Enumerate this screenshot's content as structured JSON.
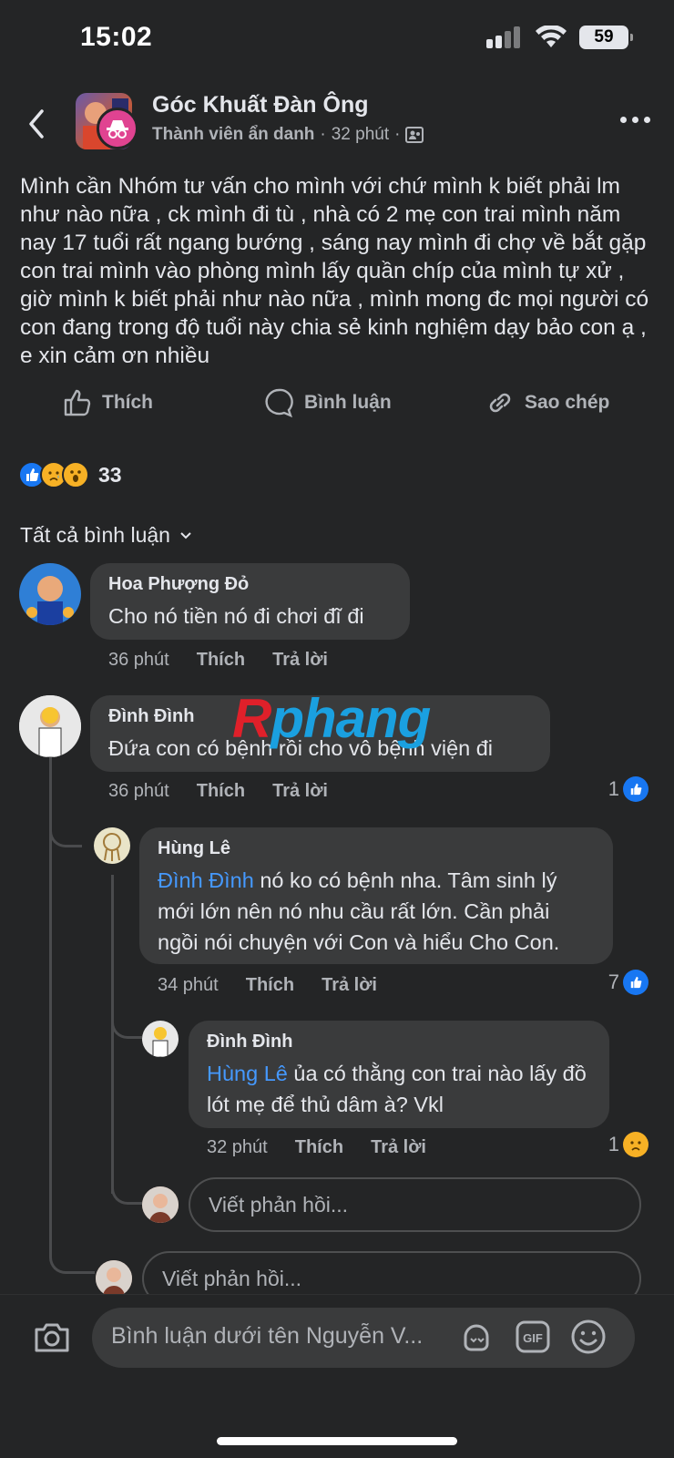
{
  "status": {
    "time": "15:02",
    "battery": "59"
  },
  "header": {
    "group_name": "Góc Khuất Đàn Ông",
    "author": "Thành viên ẩn danh",
    "sep": "·",
    "time": "32 phút",
    "sep2": "·"
  },
  "post": {
    "text": "Mình cần Nhóm tư vấn  cho mình với chứ mình k biết phải lm như nào nữa , ck mình đi tù , nhà có 2 mẹ con trai mình năm nay 17 tuổi rất ngang bướng , sáng nay mình đi chợ về bắt gặp con trai mình vào phòng mình lấy quần chíp của mình tự xử , giờ mình k biết phải như nào nữa , mình mong đc mọi người có con đang trong độ tuổi này chia sẻ kinh nghiệm dạy bảo con ạ , e xin cảm ơn nhiều"
  },
  "actions": {
    "like": "Thích",
    "comment": "Bình luận",
    "copy": "Sao chép"
  },
  "reactions": {
    "count": "33",
    "types": [
      "like",
      "sad",
      "wow"
    ]
  },
  "filter": {
    "label": "Tất cả bình luận"
  },
  "watermark": {
    "part1": "R",
    "part2": "phang"
  },
  "comments": [
    {
      "name": "Hoa Phượng Đỏ",
      "text": "Cho nó tiền nó đi chơi đĩ đi",
      "time": "36 phút",
      "like": "Thích",
      "reply": "Trả lời"
    },
    {
      "name": "Đình Đình",
      "text": "Đứa con có bệnh rồi cho vô bệnh viện đi",
      "time": "36 phút",
      "like": "Thích",
      "reply": "Trả lời",
      "reaction_count": "1"
    },
    {
      "name": "Hùng Lê",
      "tag": "Đình Đình",
      "text": " nó ko có bệnh nha. Tâm sinh lý mới lớn nên nó nhu cầu rất lớn. Cần phải ngồi nói chuyện với Con và hiểu Cho Con.",
      "time": "34 phút",
      "like": "Thích",
      "reply": "Trả lời",
      "reaction_count": "7"
    },
    {
      "name": "Đình Đình",
      "tag": "Hùng Lê",
      "text": " ủa có thằng con trai nào lấy đồ lót mẹ để thủ dâm à? Vkl",
      "time": "32 phút",
      "like": "Thích",
      "reply": "Trả lời",
      "reaction_count": "1"
    }
  ],
  "reply_inputs": {
    "placeholder1": "Viết phản hồi...",
    "placeholder2": "Viết phản hồi..."
  },
  "composer": {
    "placeholder": "Bình luận dưới tên Nguyễn V..."
  },
  "colors": {
    "background": "#242526",
    "bubble": "#3a3b3c",
    "link": "#4599ff",
    "like_blue": "#1877f2"
  }
}
